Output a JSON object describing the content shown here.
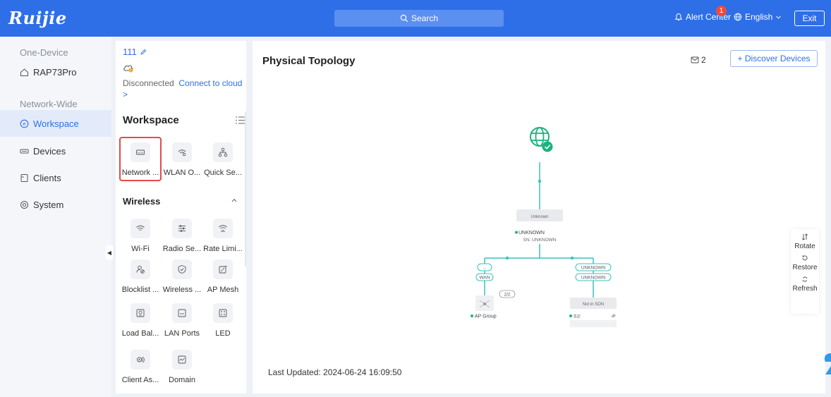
{
  "header": {
    "brand": "Ruijie",
    "search_placeholder": "Search",
    "alert_label": "Alert Center",
    "alert_count": "1",
    "language": "English",
    "exit_label": "Exit"
  },
  "leftnav": {
    "group_one": "One-Device",
    "device": "RAP73Pro",
    "group_two": "Network-Wide",
    "items": [
      {
        "label": "Workspace",
        "icon": "workspace-icon",
        "active": true
      },
      {
        "label": "Devices",
        "icon": "devices-icon"
      },
      {
        "label": "Clients",
        "icon": "clients-icon"
      },
      {
        "label": "System",
        "icon": "system-icon"
      }
    ]
  },
  "workspace": {
    "device_name": "111",
    "cloud_status": "Disconnected",
    "cloud_link": "Connect to cloud",
    "cloud_chevron": ">",
    "title": "Workspace",
    "tiles": [
      {
        "label": "Network ...",
        "icon": "wlan-icon"
      },
      {
        "label": "WLAN O...",
        "icon": "wifi-optimize-icon"
      },
      {
        "label": "Quick Se...",
        "icon": "quick-setup-icon"
      }
    ],
    "wireless_section": "Wireless",
    "wireless_tiles": [
      {
        "label": "Wi-Fi",
        "icon": "wifi-icon"
      },
      {
        "label": "Radio Se...",
        "icon": "radio-settings-icon"
      },
      {
        "label": "Rate Limi...",
        "icon": "rate-limit-icon"
      },
      {
        "label": "Blocklist ...",
        "icon": "blocklist-icon"
      },
      {
        "label": "Wireless ...",
        "icon": "wireless-security-icon"
      },
      {
        "label": "AP Mesh",
        "icon": "ap-mesh-icon"
      },
      {
        "label": "Load Bal...",
        "icon": "load-balance-icon"
      },
      {
        "label": "LAN Ports",
        "icon": "lan-ports-icon"
      },
      {
        "label": "LED",
        "icon": "led-icon"
      },
      {
        "label": "Client As...",
        "icon": "client-association-icon"
      },
      {
        "label": "Domain",
        "icon": "domain-icon"
      }
    ]
  },
  "main": {
    "title": "Physical Topology",
    "pending_count": "2",
    "discover_label": "+ Discover Devices",
    "last_updated": "Last Updated: 2024-06-24 16:09:50",
    "tools": [
      {
        "label": "Rotate",
        "icon": "rotate-icon"
      },
      {
        "label": "Restore",
        "icon": "restore-icon"
      },
      {
        "label": "Refresh",
        "icon": "refresh-icon"
      }
    ]
  },
  "topology": {
    "gateway_box": "Unknown",
    "gateway_status": "UNKNOWN",
    "gateway_sn": "SN: UNKNOWN",
    "left_port_top": "...",
    "left_port_bottom": "WAN",
    "right_port_top": "UNKNOWN",
    "right_port_bottom": "UNKNOWN",
    "ap_count": "2/2",
    "ap_group": "AP Group",
    "switch_box": "Not in SON",
    "switch_label": "S1!",
    "switch_suffix": "-P",
    "status_color": "#19b37b",
    "line_color": "#3cc0c0"
  },
  "colors": {
    "brand_blue": "#2e6fe8",
    "selection_red": "#e5484d",
    "alert_red": "#f04b3a"
  }
}
